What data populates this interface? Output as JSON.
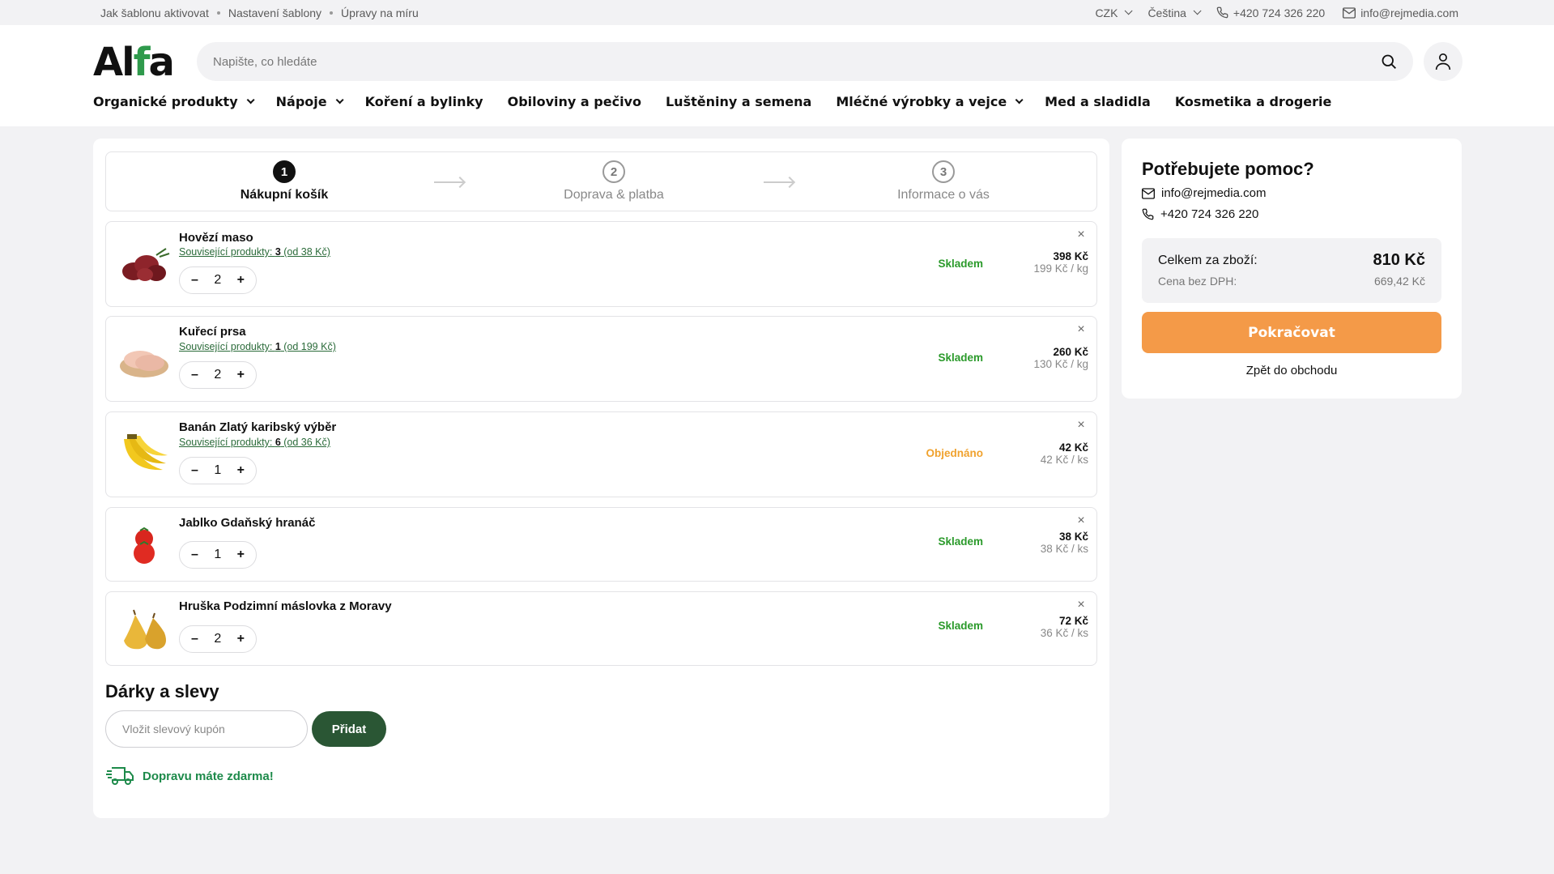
{
  "topbar": {
    "links": [
      "Jak šablonu aktivovat",
      "Nastavení šablony",
      "Úpravy na míru"
    ],
    "currency": "CZK",
    "language": "Čeština",
    "phone": "+420 724 326 220",
    "email": "info@rejmedia.com"
  },
  "header": {
    "logo_part1": "Al",
    "logo_part2": "f",
    "logo_part3": "a",
    "search_placeholder": "Napište, co hledáte",
    "nav": [
      {
        "label": "Organické produkty",
        "has_dropdown": true
      },
      {
        "label": "Nápoje",
        "has_dropdown": true
      },
      {
        "label": "Koření a bylinky",
        "has_dropdown": false
      },
      {
        "label": "Obiloviny a pečivo",
        "has_dropdown": false
      },
      {
        "label": "Luštěniny a semena",
        "has_dropdown": false
      },
      {
        "label": "Mléčné výrobky a vejce",
        "has_dropdown": true
      },
      {
        "label": "Med a sladidla",
        "has_dropdown": false
      },
      {
        "label": "Kosmetika a drogerie",
        "has_dropdown": false
      }
    ]
  },
  "steps": [
    {
      "num": "1",
      "label": "Nákupní košík",
      "active": true
    },
    {
      "num": "2",
      "label": "Doprava & platba",
      "active": false
    },
    {
      "num": "3",
      "label": "Informace o vás",
      "active": false
    }
  ],
  "cart": {
    "items": [
      {
        "name": "Hovězí maso",
        "related_prefix": "Související produkty: ",
        "related_count": "3",
        "related_from": " (od 38 Kč)",
        "qty": "2",
        "status": "Skladem",
        "status_type": "ok",
        "total": "398 Kč",
        "unit_price": "199 Kč / kg",
        "image": "beef-image"
      },
      {
        "name": "Kuřecí prsa",
        "related_prefix": "Související produkty: ",
        "related_count": "1",
        "related_from": " (od 199 Kč)",
        "qty": "2",
        "status": "Skladem",
        "status_type": "ok",
        "total": "260 Kč",
        "unit_price": "130 Kč / kg",
        "image": "chicken-image"
      },
      {
        "name": "Banán Zlatý karibský výběr",
        "related_prefix": "Související produkty: ",
        "related_count": "6",
        "related_from": " (od 36 Kč)",
        "qty": "1",
        "status": "Objednáno",
        "status_type": "ord",
        "total": "42 Kč",
        "unit_price": "42 Kč / ks",
        "image": "banana-image"
      },
      {
        "name": "Jablko Gdaňský hranáč",
        "related_prefix": "",
        "related_count": "",
        "related_from": "",
        "qty": "1",
        "status": "Skladem",
        "status_type": "ok",
        "total": "38 Kč",
        "unit_price": "38 Kč / ks",
        "image": "tomato-image"
      },
      {
        "name": "Hruška Podzimní máslovka z Moravy",
        "related_prefix": "",
        "related_count": "",
        "related_from": "",
        "qty": "2",
        "status": "Skladem",
        "status_type": "ok",
        "total": "72 Kč",
        "unit_price": "36 Kč / ks",
        "image": "pear-image"
      }
    ],
    "minus": "–",
    "plus": "+",
    "close": "×"
  },
  "gifts": {
    "title": "Dárky a slevy",
    "coupon_placeholder": "Vložit slevový kupón",
    "add_label": "Přidat",
    "free_shipping": "Dopravu máte zdarma!"
  },
  "sidebar": {
    "title": "Potřebujete pomoc?",
    "email": "info@rejmedia.com",
    "phone": "+420 724 326 220",
    "total_label": "Celkem za zboží:",
    "total_value": "810 Kč",
    "net_label": "Cena bez DPH:",
    "net_value": "669,42 Kč",
    "continue_label": "Pokračovat",
    "back_label": "Zpět do obchodu"
  },
  "colors": {
    "brand_green": "#2a5634",
    "accent_orange": "#f49a48",
    "stock_green": "#2b9a2b",
    "ordered_orange": "#f0a22e"
  }
}
